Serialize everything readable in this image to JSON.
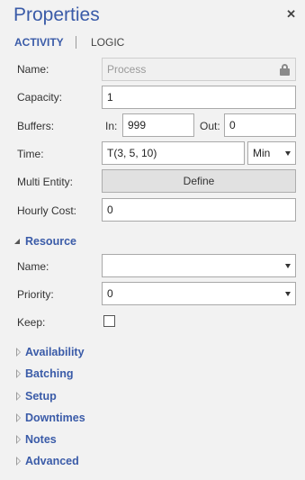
{
  "panel": {
    "title": "Properties",
    "close_glyph": "✕"
  },
  "tabs": {
    "activity": "ACTIVITY",
    "logic": "LOGIC"
  },
  "form": {
    "name_label": "Name:",
    "name_value": "Process",
    "capacity_label": "Capacity:",
    "capacity_value": "1",
    "buffers_label": "Buffers:",
    "in_label": "In:",
    "in_value": "999",
    "out_label": "Out:",
    "out_value": "0",
    "time_label": "Time:",
    "time_value": "T(3, 5, 10)",
    "time_unit": "Min",
    "multi_entity_label": "Multi Entity:",
    "define_button": "Define",
    "hourly_cost_label": "Hourly Cost:",
    "hourly_cost_value": "0"
  },
  "resource": {
    "header": "Resource",
    "name_label": "Name:",
    "name_value": "",
    "priority_label": "Priority:",
    "priority_value": "0",
    "keep_label": "Keep:",
    "keep_checked": false
  },
  "sections": {
    "availability": "Availability",
    "batching": "Batching",
    "setup": "Setup",
    "downtimes": "Downtimes",
    "notes": "Notes",
    "advanced": "Advanced"
  },
  "icons": {
    "close": "close-icon",
    "lock": "lock-icon",
    "dropdown": "chevron-down-icon",
    "expanded": "expanded-triangle-icon",
    "collapsed": "collapsed-triangle-icon"
  },
  "colors": {
    "accent": "#3a5ba8",
    "background": "#f2f2f2",
    "field_border": "#a9a9a9"
  }
}
